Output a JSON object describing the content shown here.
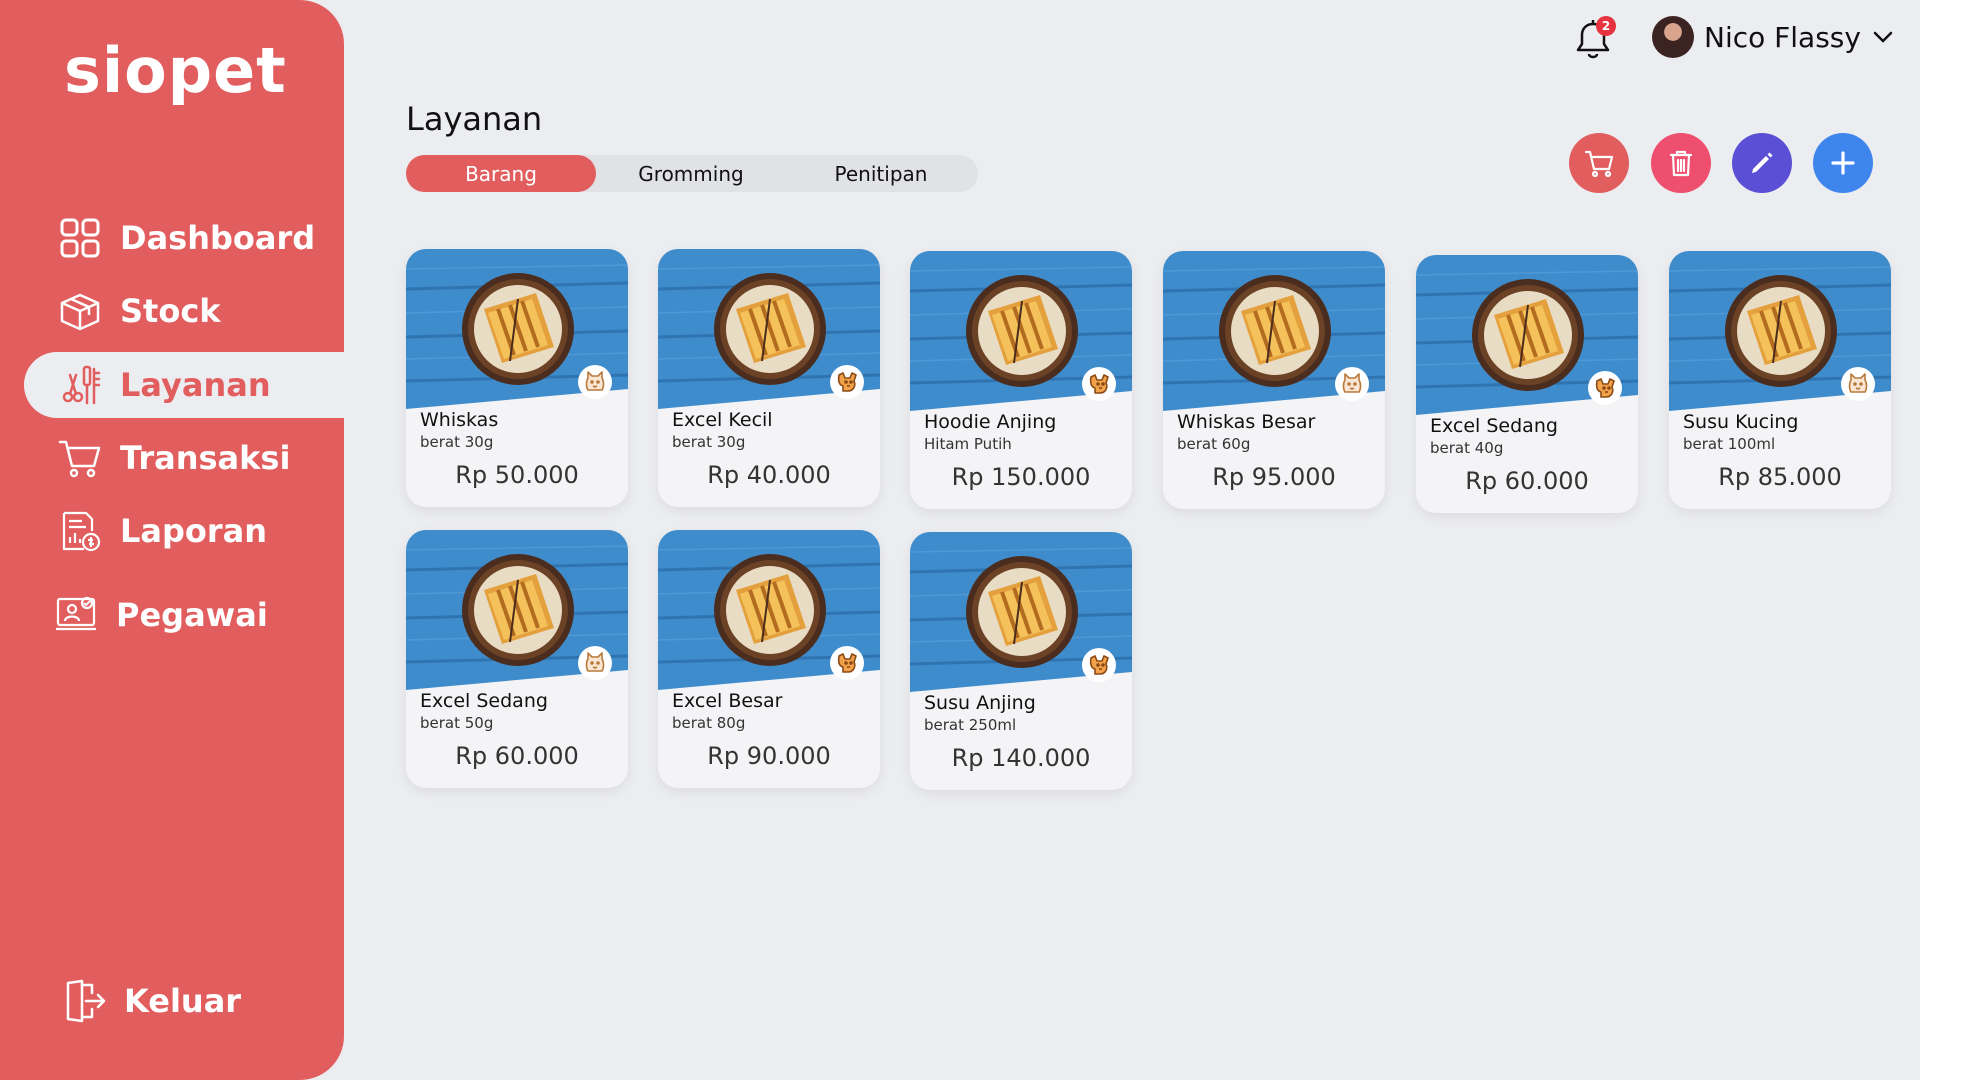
{
  "app": {
    "logo": "siopet",
    "colors": {
      "primary": "#e25e5e",
      "background": "#ecedf0",
      "card": "#f4f4f6"
    }
  },
  "sidebar": {
    "items": [
      {
        "label": "Dashboard",
        "icon": "grid-icon",
        "active": false
      },
      {
        "label": "Stock",
        "icon": "box-icon",
        "active": false
      },
      {
        "label": "Layanan",
        "icon": "grooming-tools-icon",
        "active": true
      },
      {
        "label": "Transaksi",
        "icon": "cart-icon",
        "active": false
      },
      {
        "label": "Laporan",
        "icon": "report-icon",
        "active": false
      },
      {
        "label": "Pegawai",
        "icon": "employee-icon",
        "active": false
      }
    ],
    "logout": {
      "label": "Keluar",
      "icon": "logout-icon"
    }
  },
  "header": {
    "notification_count": "2",
    "user_name": "Nico Flassy"
  },
  "page": {
    "title": "Layanan",
    "tabs": [
      {
        "label": "Barang",
        "active": true
      },
      {
        "label": "Gromming",
        "active": false
      },
      {
        "label": "Penitipan",
        "active": false
      }
    ],
    "actions": [
      {
        "name": "cart",
        "icon": "cart-icon",
        "color": "#e25e5e"
      },
      {
        "name": "delete",
        "icon": "trash-icon",
        "color": "#ef4f6e"
      },
      {
        "name": "edit",
        "icon": "pencil-icon",
        "color": "#5b4fd6"
      },
      {
        "name": "add",
        "icon": "plus-icon",
        "color": "#3e86ee"
      }
    ]
  },
  "products": [
    {
      "name": "Whiskas",
      "sub": "berat 30g",
      "price": "Rp 50.000",
      "pet": "cat"
    },
    {
      "name": "Excel Kecil",
      "sub": "berat 30g",
      "price": "Rp 40.000",
      "pet": "dog"
    },
    {
      "name": "Hoodie Anjing",
      "sub": "Hitam Putih",
      "price": "Rp 150.000",
      "pet": "dog"
    },
    {
      "name": "Whiskas Besar",
      "sub": "berat 60g",
      "price": "Rp 95.000",
      "pet": "cat"
    },
    {
      "name": "Excel Sedang",
      "sub": "berat 40g",
      "price": "Rp 60.000",
      "pet": "dog"
    },
    {
      "name": "Susu Kucing",
      "sub": "berat 100ml",
      "price": "Rp 85.000",
      "pet": "cat"
    },
    {
      "name": "Excel Sedang",
      "sub": "berat 50g",
      "price": "Rp 60.000",
      "pet": "cat"
    },
    {
      "name": "Excel Besar",
      "sub": "berat 80g",
      "price": "Rp 90.000",
      "pet": "dog"
    },
    {
      "name": "Susu Anjing",
      "sub": "berat 250ml",
      "price": "Rp 140.000",
      "pet": "dog"
    }
  ]
}
